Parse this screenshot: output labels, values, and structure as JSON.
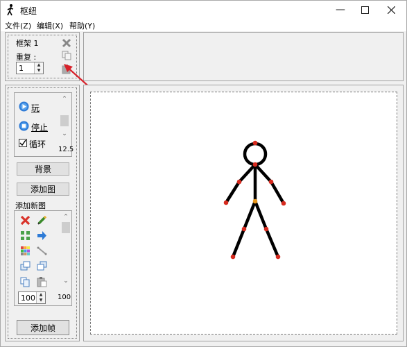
{
  "window": {
    "title": "枢纽"
  },
  "menu": [
    "文件(Z)",
    "编辑(X)",
    "帮助(Y)"
  ],
  "frame_panel": {
    "frame_label": "框架 1",
    "repeat_label": "重复 :",
    "repeat_value": "1"
  },
  "playback": {
    "play_label": "玩",
    "stop_label": "停止",
    "loop_label": "循环",
    "loop_checked": true,
    "speed_value": "12.5"
  },
  "buttons": {
    "background": "背景",
    "add_image": "添加图",
    "add_frame": "添加帧"
  },
  "figure_tools": {
    "section_label": "添加新图",
    "size_value": "100",
    "slider_value": "100"
  },
  "colors": {
    "accent_blue": "#2e7bd6",
    "delete_red": "#d9342b",
    "arrow_red": "#d8212a",
    "joint_red": "#d62a1e",
    "joint_orange": "#e8961a"
  }
}
